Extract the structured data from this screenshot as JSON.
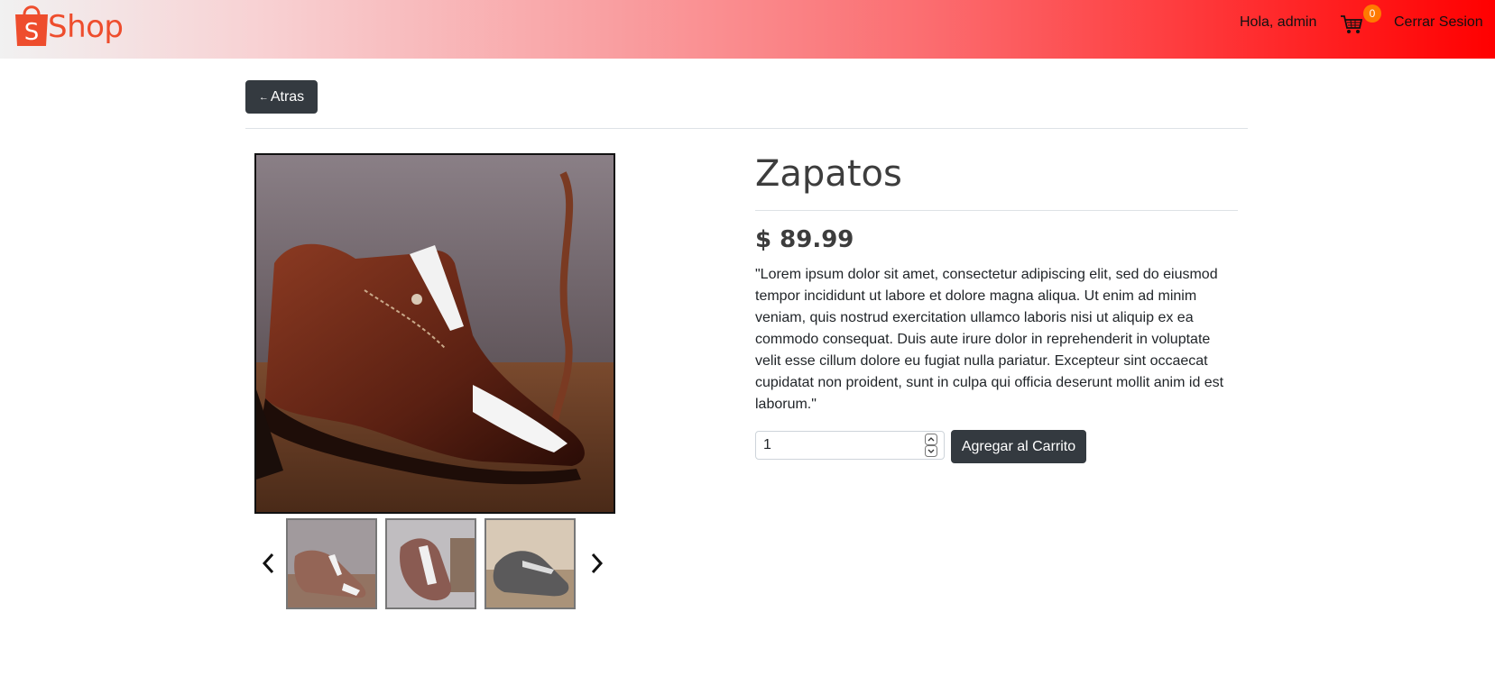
{
  "header": {
    "logo_icon": "shopping-bag-icon",
    "logo_text": "Shop",
    "greeting": "Hola, admin",
    "cart_icon": "shopping-cart-icon",
    "cart_count": "0",
    "logout_label": "Cerrar Sesion",
    "colors": {
      "brand": "#ee4d2d",
      "gradient_end": "#ff0000",
      "badge": "#ff7a00"
    }
  },
  "nav": {
    "back_label": "Atras",
    "back_icon": "left-arrow-icon"
  },
  "gallery": {
    "prev_icon": "chevron-left-icon",
    "next_icon": "chevron-right-icon",
    "thumbnail_count": 3
  },
  "product": {
    "title": "Zapatos",
    "price": "$ 89.99",
    "description": "\"Lorem ipsum dolor sit amet, consectetur adipiscing elit, sed do eiusmod tempor incididunt ut labore et dolore magna aliqua. Ut enim ad minim veniam, quis nostrud exercitation ullamco laboris nisi ut aliquip ex ea commodo consequat. Duis aute irure dolor in reprehenderit in voluptate velit esse cillum dolore eu fugiat nulla pariatur. Excepteur sint occaecat cupidatat non proident, sunt in culpa qui officia deserunt mollit anim id est laborum.\"",
    "quantity": "1",
    "add_to_cart_label": "Agregar al Carrito",
    "button_color": "#343a40"
  }
}
